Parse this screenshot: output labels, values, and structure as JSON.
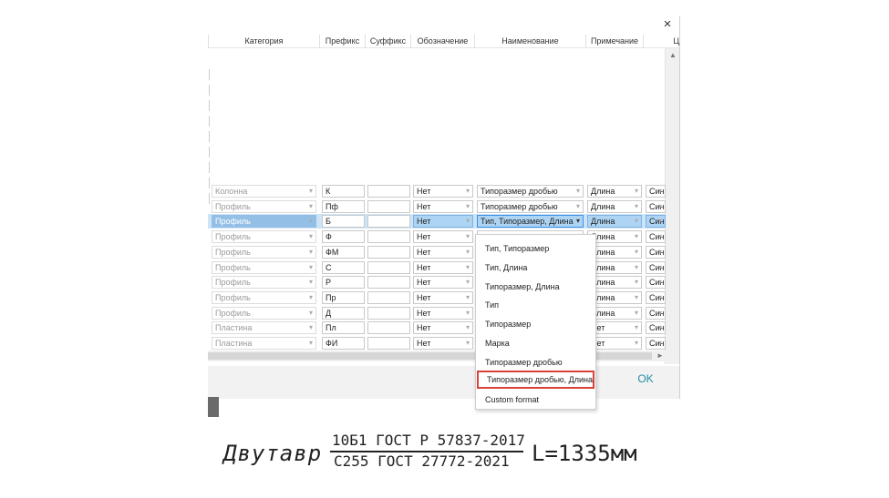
{
  "dialog": {
    "close_label": "×",
    "ok_label": "OK"
  },
  "columns": [
    "Категория",
    "Префикс",
    "Суффикс",
    "Обозначение",
    "Наименование",
    "Примечание",
    "Ц"
  ],
  "rows": [
    {
      "category": "Колонна",
      "prefix": "К",
      "suffix": "",
      "designation": "Нет",
      "name": "Типоразмер дробью",
      "note": "Длина",
      "last": "Синий"
    },
    {
      "category": "Профиль",
      "prefix": "Пф",
      "suffix": "",
      "designation": "Нет",
      "name": "Типоразмер дробью",
      "note": "Длина",
      "last": "Синий"
    },
    {
      "category": "Профиль",
      "prefix": "Б",
      "suffix": "",
      "designation": "Нет",
      "name": "Тип, Типоразмер, Длина",
      "note": "Длина",
      "last": "Синий"
    },
    {
      "category": "Профиль",
      "prefix": "Ф",
      "suffix": "",
      "designation": "Нет",
      "name": "",
      "note": "Длина",
      "last": "Синий"
    },
    {
      "category": "Профиль",
      "prefix": "ФМ",
      "suffix": "",
      "designation": "Нет",
      "name": "",
      "note": "Длина",
      "last": "Синий"
    },
    {
      "category": "Профиль",
      "prefix": "С",
      "suffix": "",
      "designation": "Нет",
      "name": "",
      "note": "Длина",
      "last": "Синий"
    },
    {
      "category": "Профиль",
      "prefix": "Р",
      "suffix": "",
      "designation": "Нет",
      "name": "",
      "note": "Длина",
      "last": "Синий"
    },
    {
      "category": "Профиль",
      "prefix": "Пр",
      "suffix": "",
      "designation": "Нет",
      "name": "",
      "note": "Длина",
      "last": "Синий"
    },
    {
      "category": "Профиль",
      "prefix": "Д",
      "suffix": "",
      "designation": "Нет",
      "name": "",
      "note": "Длина",
      "last": "Синий"
    },
    {
      "category": "Пластина",
      "prefix": "Пл",
      "suffix": "",
      "designation": "Нет",
      "name": "",
      "note": "Нет",
      "last": "Синий"
    },
    {
      "category": "Пластина",
      "prefix": "ФИ",
      "suffix": "",
      "designation": "Нет",
      "name": "",
      "note": "Нет",
      "last": "Синий"
    }
  ],
  "dropdown_options": [
    "Тип, Типоразмер",
    "Тип, Длина",
    "Типоразмер, Длина",
    "Тип",
    "Типоразмер",
    "Марка",
    "Типоразмер дробью",
    "Типоразмер дробью, Длина",
    "Custom format"
  ],
  "formula": {
    "lead": "Двутавр",
    "numerator": "10Б1 ГОСТ Р 57837-2017",
    "denominator": "С255 ГОСТ 27772-2021",
    "tail": "L=1335мм"
  },
  "colors": {
    "selection": "#cce4f7",
    "accent": "#1e8fa8",
    "highlight_border": "#d9423a"
  },
  "icons": {
    "close": "close-icon",
    "combo": "chevron-down-icon",
    "scroll_up": "arrow-up-icon",
    "scroll_down": "arrow-down-icon",
    "scroll_right": "arrow-right-icon"
  }
}
